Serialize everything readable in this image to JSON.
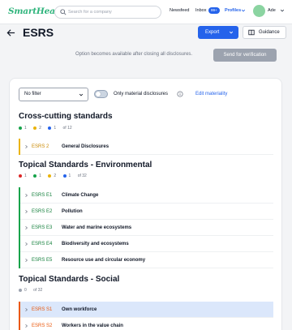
{
  "nav": {
    "logo": "SmartHead",
    "search_placeholder": "Search for a company",
    "newsfeed": "Newsfeed",
    "inbox": "Inbox",
    "inbox_badge": "99+",
    "profiles": "Profiles",
    "user_initials": "",
    "user_name": "Ade"
  },
  "header": {
    "title": "ESRS",
    "export_label": "Export",
    "guidance_label": "Guidance",
    "hint": "Option becomes available after closing all disclosures.",
    "verify_label": "Send for verification"
  },
  "filters": {
    "select_value": "No filter",
    "toggle_label": "Only material disclosures",
    "edit_link": "Edit materiality"
  },
  "sections": [
    {
      "title": "Cross-cutting standards",
      "legend": [
        {
          "color": "#16a34a",
          "count": "1"
        },
        {
          "color": "#eab308",
          "count": "2"
        },
        {
          "color": "#2563eb",
          "count": "1"
        }
      ],
      "total": "of 12",
      "rows": [
        {
          "code": "ESRS 2",
          "name": "General Disclosures",
          "color": "#eab308"
        }
      ]
    },
    {
      "title": "Topical Standards - Environmental",
      "legend": [
        {
          "color": "#dc2626",
          "count": "1"
        },
        {
          "color": "#16a34a",
          "count": "1"
        },
        {
          "color": "#eab308",
          "count": "2"
        },
        {
          "color": "#2563eb",
          "count": "1"
        }
      ],
      "total": "of 32",
      "rows": [
        {
          "code": "ESRS E1",
          "name": "Climate Change",
          "color": "#16a34a"
        },
        {
          "code": "ESRS E2",
          "name": "Pollution",
          "color": "#16a34a"
        },
        {
          "code": "ESRS E3",
          "name": "Water and marine ecosystems",
          "color": "#16a34a"
        },
        {
          "code": "ESRS E4",
          "name": "Biodiversity and ecosystems",
          "color": "#16a34a"
        },
        {
          "code": "ESRS E5",
          "name": "Resource use and circular economy",
          "color": "#16a34a"
        }
      ]
    },
    {
      "title": "Topical Standards - Social",
      "legend": [
        {
          "color": "#9ca3af",
          "count": "0"
        }
      ],
      "total": "of 32",
      "rows": [
        {
          "code": "ESRS S1",
          "name": "Own workforce",
          "color": "#ea580c"
        },
        {
          "code": "ESRS S2",
          "name": "Workers in the value chain",
          "color": "#ea580c"
        }
      ]
    }
  ]
}
